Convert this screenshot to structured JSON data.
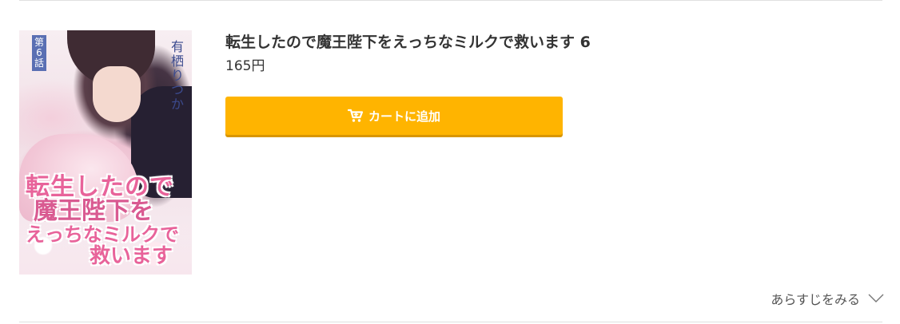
{
  "cover": {
    "badge": "第6話",
    "author": "有栖りつか",
    "logo_line1": "転生したので",
    "logo_line2": "魔王陛下を",
    "logo_line3": "えっちなミルクで",
    "logo_line4": "救います"
  },
  "product": {
    "title": "転生したので魔王陛下をえっちなミルクで救います 6",
    "price": "165円"
  },
  "actions": {
    "cart_label": "カートに追加",
    "cart_icon": "cart-icon",
    "synopsis_label": "あらすじをみる",
    "synopsis_icon": "chevron-down-icon"
  },
  "colors": {
    "cart_button": "#ffb400",
    "cart_button_shadow": "#d99600",
    "text": "#333333",
    "divider": "#e0e0e0"
  }
}
